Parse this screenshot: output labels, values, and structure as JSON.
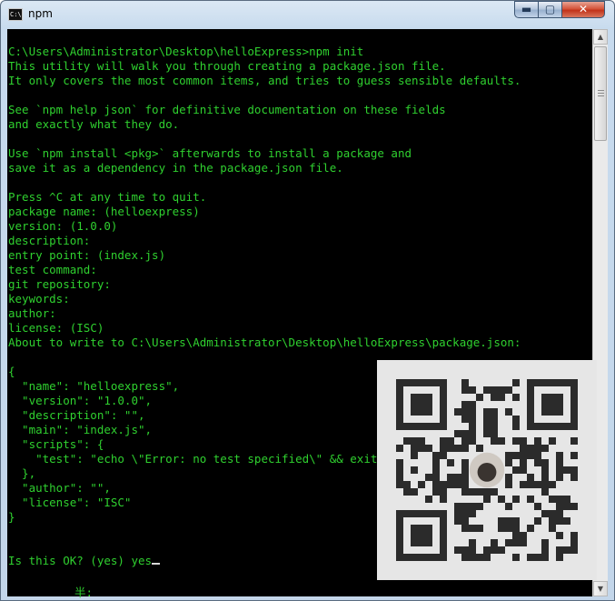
{
  "window": {
    "title": "npm",
    "icon_text": "C:\\",
    "controls": {
      "minimize_glyph": "▬",
      "maximize_glyph": "▢",
      "close_glyph": "✕"
    }
  },
  "console": {
    "lines": [
      "C:\\Users\\Administrator\\Desktop\\helloExpress>npm init",
      "This utility will walk you through creating a package.json file.",
      "It only covers the most common items, and tries to guess sensible defaults.",
      "",
      "See `npm help json` for definitive documentation on these fields",
      "and exactly what they do.",
      "",
      "Use `npm install <pkg>` afterwards to install a package and",
      "save it as a dependency in the package.json file.",
      "",
      "Press ^C at any time to quit.",
      "package name: (helloexpress)",
      "version: (1.0.0)",
      "description:",
      "entry point: (index.js)",
      "test command:",
      "git repository:",
      "keywords:",
      "author:",
      "license: (ISC)",
      "About to write to C:\\Users\\Administrator\\Desktop\\helloExpress\\package.json:",
      "",
      "{",
      "  \"name\": \"helloexpress\",",
      "  \"version\": \"1.0.0\",",
      "  \"description\": \"\",",
      "  \"main\": \"index.js\",",
      "  \"scripts\": {",
      "    \"test\": \"echo \\\"Error: no test specified\\\" && exit 1\"",
      "  },",
      "  \"author\": \"\",",
      "  \"license\": \"ISC\"",
      "}",
      "",
      "",
      "Is this OK? (yes) yes"
    ],
    "ime_char": "半:",
    "text_color": "#2fd02f",
    "background_color": "#000000"
  },
  "scrollbar": {
    "up_glyph": "▲",
    "down_glyph": "▼"
  },
  "overlay": {
    "type": "qr-code",
    "has_center_avatar": true
  }
}
